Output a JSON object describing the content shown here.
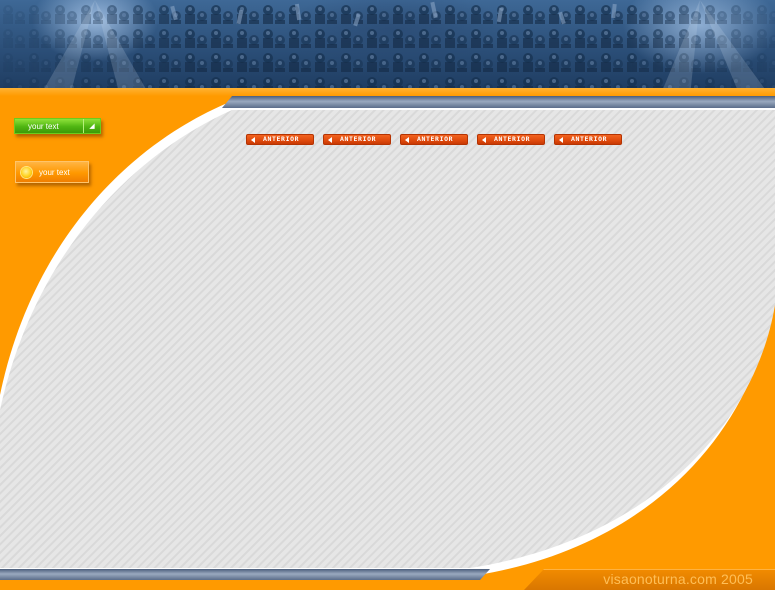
{
  "header": {
    "banner_image": "crowd-photo"
  },
  "sidebar": {
    "green_button": {
      "label": "your text",
      "icon": "arrow-icon"
    },
    "orange_button": {
      "label": "your text",
      "icon": "sun-icon"
    }
  },
  "nav": {
    "buttons": [
      {
        "label": "ANTERIOR",
        "icon": "left-arrow-icon"
      },
      {
        "label": "ANTERIOR",
        "icon": "left-arrow-icon"
      },
      {
        "label": "ANTERIOR",
        "icon": "left-arrow-icon"
      },
      {
        "label": "ANTERIOR",
        "icon": "left-arrow-icon"
      },
      {
        "label": "ANTERIOR",
        "icon": "left-arrow-icon"
      }
    ]
  },
  "footer": {
    "text": "visaonoturna.com 2005"
  },
  "colors": {
    "background": "#ff9a00",
    "panel": "#e4e4e4",
    "nav_button": "#e04a0c",
    "green_button": "#4fb512",
    "banner": "#2a4d76"
  }
}
